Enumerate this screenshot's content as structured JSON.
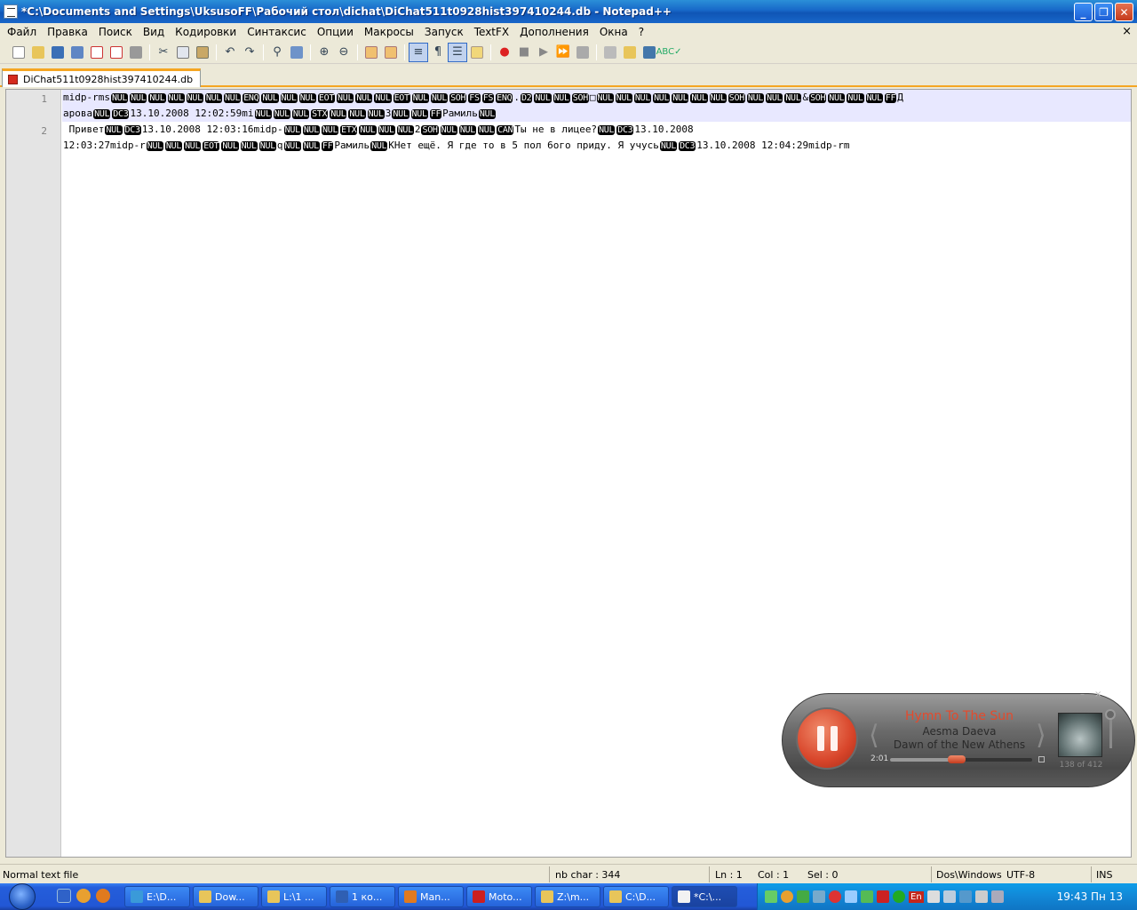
{
  "window": {
    "title": "*C:\\Documents and Settings\\UksusoFF\\Рабочий стол\\dichat\\DiChat511t0928hist397410244.db - Notepad++"
  },
  "menu": {
    "items": [
      {
        "label": "Файл"
      },
      {
        "label": "Правка"
      },
      {
        "label": "Поиск"
      },
      {
        "label": "Вид"
      },
      {
        "label": "Кодировки"
      },
      {
        "label": "Синтаксис"
      },
      {
        "label": "Опции"
      },
      {
        "label": "Макросы"
      },
      {
        "label": "Запуск"
      },
      {
        "label": "TextFX"
      },
      {
        "label": "Дополнения"
      },
      {
        "label": "Окна"
      },
      {
        "label": "?"
      }
    ],
    "close_glyph": "×"
  },
  "tab": {
    "label": "DiChat511t0928hist397410244.db"
  },
  "editor": {
    "line_numbers": [
      "1",
      "2"
    ],
    "lines": [
      [
        {
          "t": "midp-rms"
        },
        {
          "c": "NUL"
        },
        {
          "c": "NUL"
        },
        {
          "c": "NUL"
        },
        {
          "c": "NUL"
        },
        {
          "c": "NUL"
        },
        {
          "c": "NUL"
        },
        {
          "c": "NUL"
        },
        {
          "c": "ENQ"
        },
        {
          "c": "NUL"
        },
        {
          "c": "NUL"
        },
        {
          "c": "NUL"
        },
        {
          "c": "EOT"
        },
        {
          "c": "NUL"
        },
        {
          "c": "NUL"
        },
        {
          "c": "NUL"
        },
        {
          "c": "EOT"
        },
        {
          "c": "NUL"
        },
        {
          "c": "NUL"
        },
        {
          "c": "SOH"
        },
        {
          "c": "FS"
        },
        {
          "c": "FS"
        },
        {
          "c": "ENQ"
        },
        {
          "t": "."
        },
        {
          "c": "D2"
        },
        {
          "c": "NUL"
        },
        {
          "c": "NUL"
        },
        {
          "c": "SOH"
        },
        {
          "t": "□"
        },
        {
          "c": "NUL"
        },
        {
          "c": "NUL"
        },
        {
          "c": "NUL"
        },
        {
          "c": "NUL"
        },
        {
          "c": "NUL"
        },
        {
          "c": "NUL"
        },
        {
          "c": "NUL"
        },
        {
          "c": "SOH"
        },
        {
          "c": "NUL"
        },
        {
          "c": "NUL"
        },
        {
          "c": "NUL"
        },
        {
          "t": "&"
        },
        {
          "c": "SOH"
        },
        {
          "c": "NUL"
        },
        {
          "c": "NUL"
        },
        {
          "c": "NUL"
        },
        {
          "c": "FF"
        },
        {
          "t": "Д"
        }
      ],
      [
        {
          "t": "арова"
        },
        {
          "c": "NUL"
        },
        {
          "c": "DC3"
        },
        {
          "t": "13.10.2008 12:02:59mi"
        },
        {
          "c": "NUL"
        },
        {
          "c": "NUL"
        },
        {
          "c": "NUL"
        },
        {
          "c": "STX"
        },
        {
          "c": "NUL"
        },
        {
          "c": "NUL"
        },
        {
          "c": "NUL"
        },
        {
          "t": "3"
        },
        {
          "c": "NUL"
        },
        {
          "c": "NUL"
        },
        {
          "c": "FF"
        },
        {
          "t": "Рамиль"
        },
        {
          "c": "NUL"
        }
      ],
      [
        {
          "t": " Привет"
        },
        {
          "c": "NUL"
        },
        {
          "c": "DC3"
        },
        {
          "t": "13.10.2008 12:03:16midp-"
        },
        {
          "c": "NUL"
        },
        {
          "c": "NUL"
        },
        {
          "c": "NUL"
        },
        {
          "c": "ETX"
        },
        {
          "c": "NUL"
        },
        {
          "c": "NUL"
        },
        {
          "c": "NUL"
        },
        {
          "t": "2"
        },
        {
          "c": "SOH"
        },
        {
          "c": "NUL"
        },
        {
          "c": "NUL"
        },
        {
          "c": "NUL"
        },
        {
          "c": "CAN"
        },
        {
          "t": "Ты не в лицее?"
        },
        {
          "c": "NUL"
        },
        {
          "c": "DC3"
        },
        {
          "t": "13.10.2008"
        }
      ],
      [
        {
          "t": "12:03:27midp-r"
        },
        {
          "c": "NUL"
        },
        {
          "c": "NUL"
        },
        {
          "c": "NUL"
        },
        {
          "c": "EOT"
        },
        {
          "c": "NUL"
        },
        {
          "c": "NUL"
        },
        {
          "c": "NUL"
        },
        {
          "t": "q"
        },
        {
          "c": "NUL"
        },
        {
          "c": "NUL"
        },
        {
          "c": "FF"
        },
        {
          "t": "Рамиль"
        },
        {
          "c": "NUL"
        },
        {
          "t": "KНет ещё. Я где то в 5 пол 6ого приду. Я учусь"
        },
        {
          "c": "NUL"
        },
        {
          "c": "DC3"
        },
        {
          "t": "13.10.2008 12:04:29midp-rm"
        }
      ]
    ]
  },
  "player": {
    "track_title": "Hymn To The Sun",
    "artist": "Aesma Daeva",
    "album": "Dawn of the New Athens",
    "elapsed": "2:01",
    "playlist_position": "138 of 412",
    "progress_fraction": 0.47,
    "accent_color": "#e44a2c",
    "minimize_glyph": "–",
    "close_glyph": "×"
  },
  "status": {
    "file_type": "Normal text file",
    "nb_char": "nb char : 344",
    "ln": "Ln : 1",
    "col": "Col : 1",
    "sel": "Sel : 0",
    "eol": "Dos\\Windows",
    "encoding": "UTF-8",
    "mode": "INS"
  },
  "taskbar": {
    "tasks": [
      {
        "label": "E:\\D...",
        "icon": "ie-icon",
        "color": "#3a9ad9"
      },
      {
        "label": "Dow...",
        "icon": "folder-icon",
        "color": "#e8c55a"
      },
      {
        "label": "L:\\1 ...",
        "icon": "folder-icon",
        "color": "#e8c55a"
      },
      {
        "label": "1 ко...",
        "icon": "word-icon",
        "color": "#2f5fb3"
      },
      {
        "label": "Man...",
        "icon": "firefox-icon",
        "color": "#e07a1f"
      },
      {
        "label": "Moto...",
        "icon": "opera-icon",
        "color": "#cc1f1f"
      },
      {
        "label": "Z:\\m...",
        "icon": "folder-icon",
        "color": "#e8c55a"
      },
      {
        "label": "C:\\D...",
        "icon": "folder-icon",
        "color": "#e8c55a"
      },
      {
        "label": "*C:\\...",
        "icon": "notepad-icon",
        "color": "#f2f2f2"
      }
    ],
    "language": "En",
    "clock": "19:43 Пн 13"
  }
}
